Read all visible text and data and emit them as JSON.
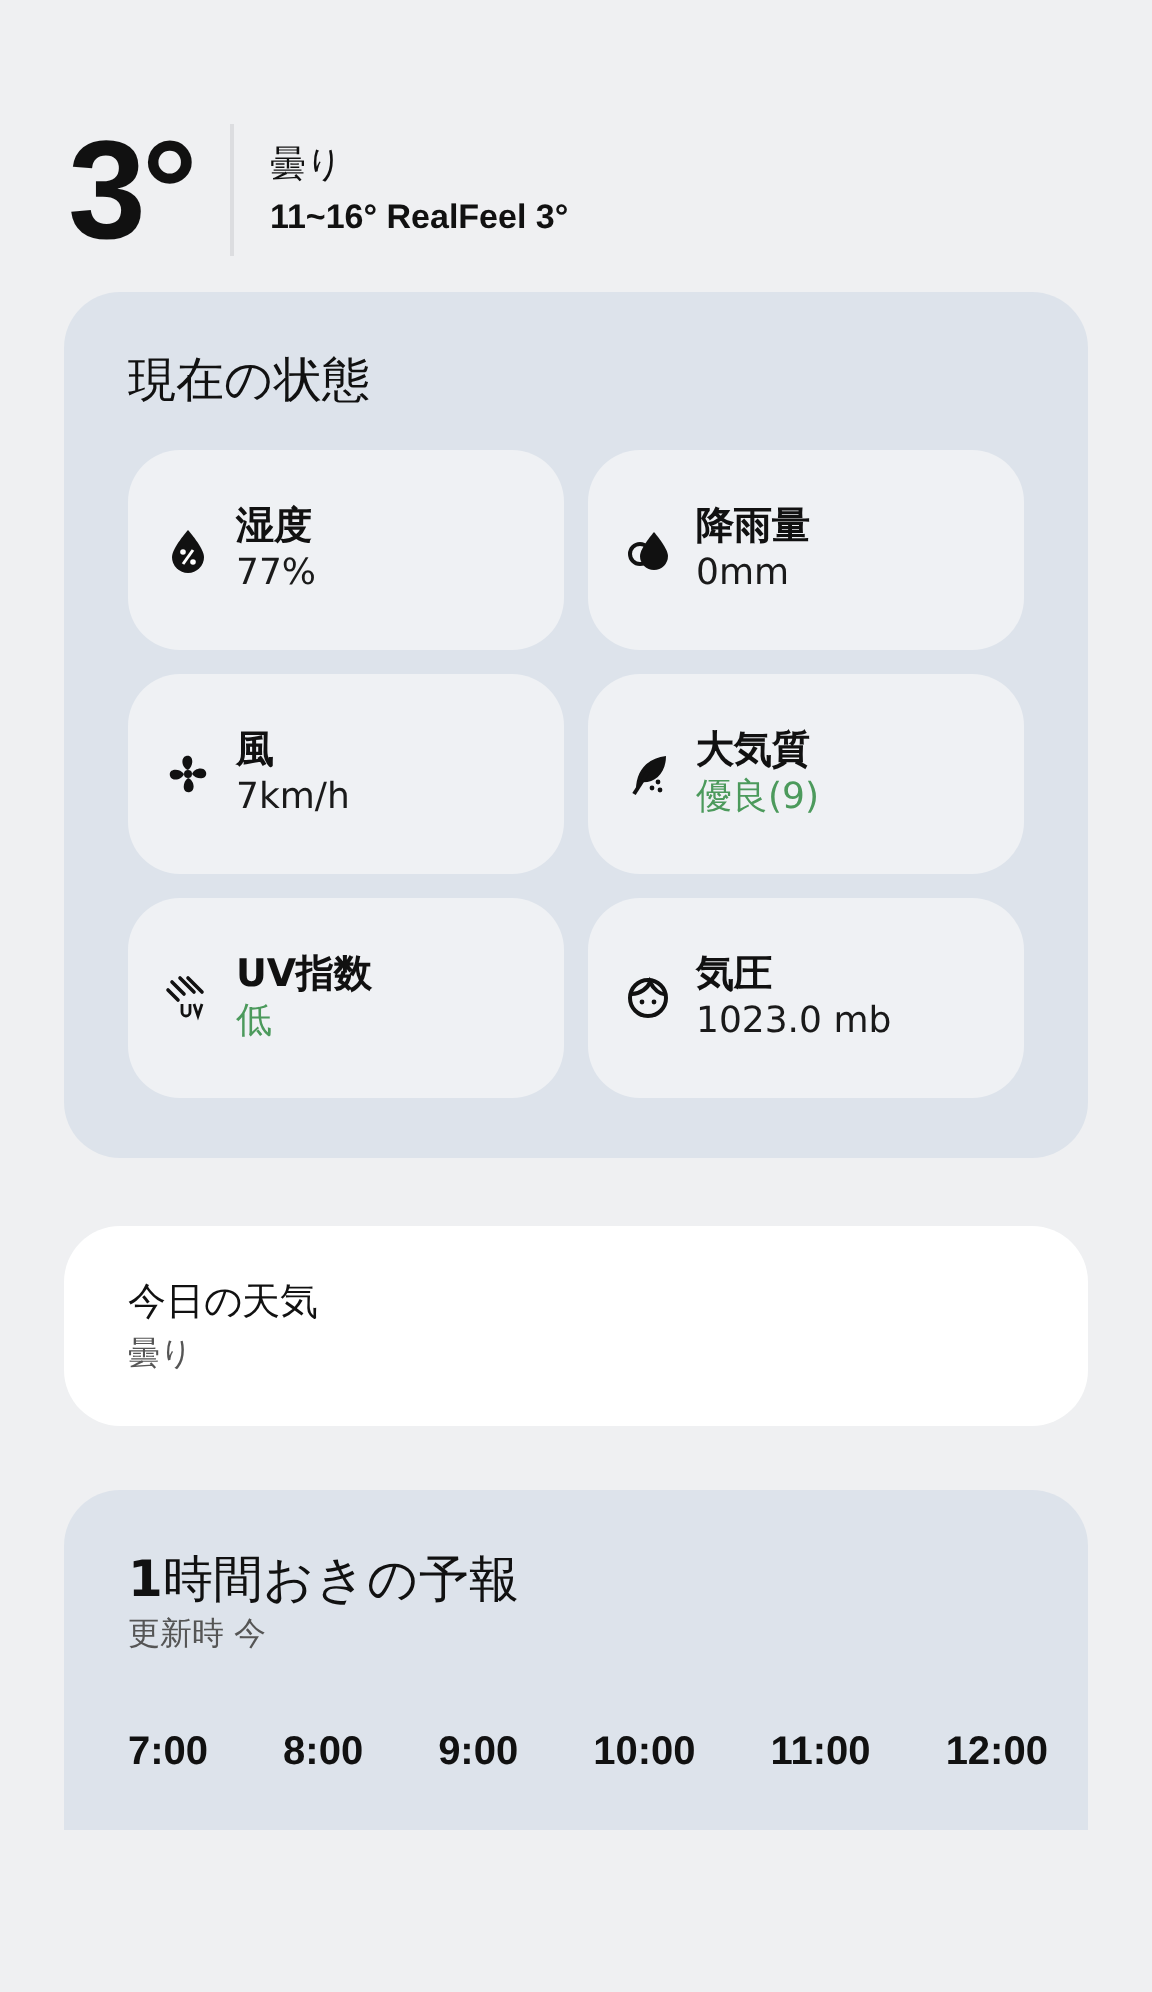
{
  "current": {
    "temperature": "3°",
    "condition": "曇り",
    "range": "11~16° RealFeel 3°"
  },
  "conditions": {
    "title": "現在の状態",
    "tiles": [
      {
        "kind": "humidity",
        "label": "湿度",
        "value": "77%",
        "color": "#1a1a1a"
      },
      {
        "kind": "rain",
        "label": "降雨量",
        "value": "0mm",
        "color": "#1a1a1a"
      },
      {
        "kind": "wind",
        "label": "風",
        "value": "7km/h",
        "color": "#1a1a1a"
      },
      {
        "kind": "air",
        "label": "大気質",
        "value": "優良(9)",
        "color": "#4c9a5c"
      },
      {
        "kind": "uv",
        "label": "UV指数",
        "value": "低",
        "color": "#4c9a5c"
      },
      {
        "kind": "pressure",
        "label": "気圧",
        "value": "1023.0 mb",
        "color": "#1a1a1a"
      }
    ]
  },
  "today": {
    "title": "今日の天気",
    "summary": "曇り"
  },
  "hourly": {
    "title": "**1**時間おきの予報",
    "updated": "更新時 今",
    "hours": [
      "7:00",
      "8:00",
      "9:00",
      "10:00",
      "11:00",
      "12:00"
    ]
  }
}
